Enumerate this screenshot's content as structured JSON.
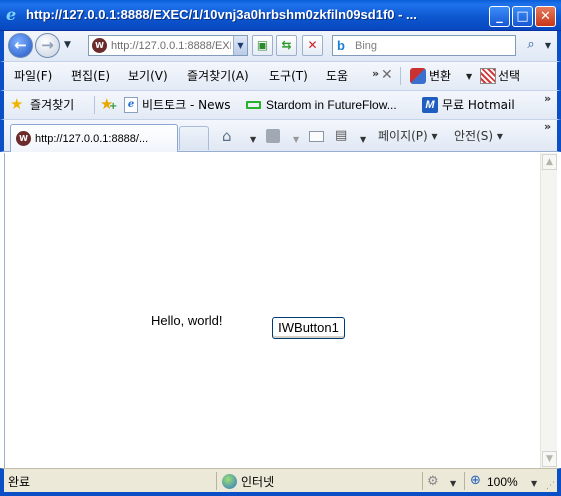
{
  "window": {
    "title": "http://127.0.0.1:8888/EXEC/1/10vnj3a0hrbshm0zkfiln09sd1f0 - ...",
    "app_icon": "ie-logo-icon",
    "min_icon": "minimize-icon",
    "max_icon": "maximize-icon",
    "close_icon": "close-icon"
  },
  "address_bar": {
    "url": "http://127.0.0.1:8888/EXEC/1/10vnj3a0hrbshm0zkfiln09sd1f0",
    "search_placeholder": "Bing",
    "bing_glyph": "b"
  },
  "menu": {
    "items": [
      "파일(F)",
      "편집(E)",
      "보기(V)",
      "즐겨찾기(A)",
      "도구(T)",
      "도움"
    ],
    "extra_chevron": "»",
    "close_glyph": "✕",
    "convert_label": "변환",
    "select_label": "선택"
  },
  "favorites": {
    "label": "즐겨찾기",
    "links": [
      "비트토크 - News",
      "Stardom in FutureFlow...",
      "무료 Hotmail"
    ],
    "hotmail_glyph": "M",
    "chevron": "»"
  },
  "tabs": {
    "active_title": "http://127.0.0.1:8888/...",
    "commands": {
      "page": "페이지(P) ▾",
      "safety": "안전(S) ▾"
    },
    "chevron": "»"
  },
  "content": {
    "hello_text": "Hello, world!",
    "button_label": "IWButton1"
  },
  "status": {
    "text": "완료",
    "zone": "인터넷",
    "zoom": "100%"
  },
  "colors": {
    "titlebar": "#0d58d0",
    "frame": "#0b4fc7",
    "statusbar": "#ece9d8"
  }
}
